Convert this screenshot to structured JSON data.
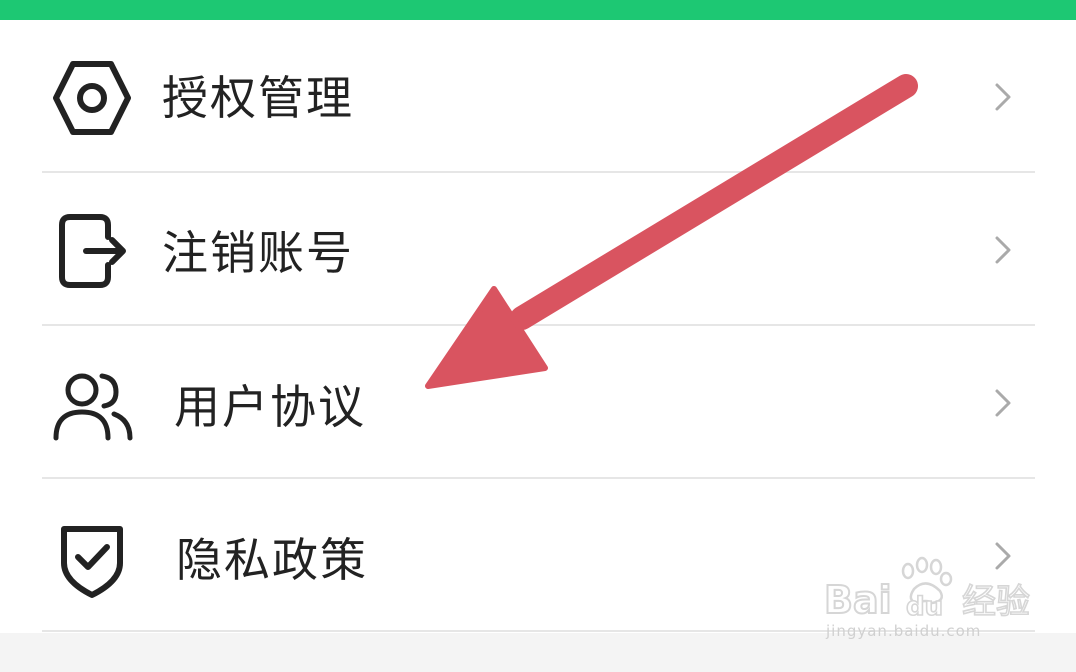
{
  "header": {
    "accent_color": "#1dc873"
  },
  "menu": {
    "items": [
      {
        "label": "授权管理",
        "icon": "hexagon-nut-icon"
      },
      {
        "label": "注销账号",
        "icon": "logout-icon"
      },
      {
        "label": "用户协议",
        "icon": "users-icon"
      },
      {
        "label": "隐私政策",
        "icon": "shield-check-icon"
      }
    ],
    "chevron_icon": "chevron-right-icon"
  },
  "annotation": {
    "arrow_color": "#d95460",
    "arrow_icon": "red-arrow-annotation"
  },
  "watermark": {
    "brand": "Bai du 经验",
    "url": "jingyan.baidu.com"
  }
}
